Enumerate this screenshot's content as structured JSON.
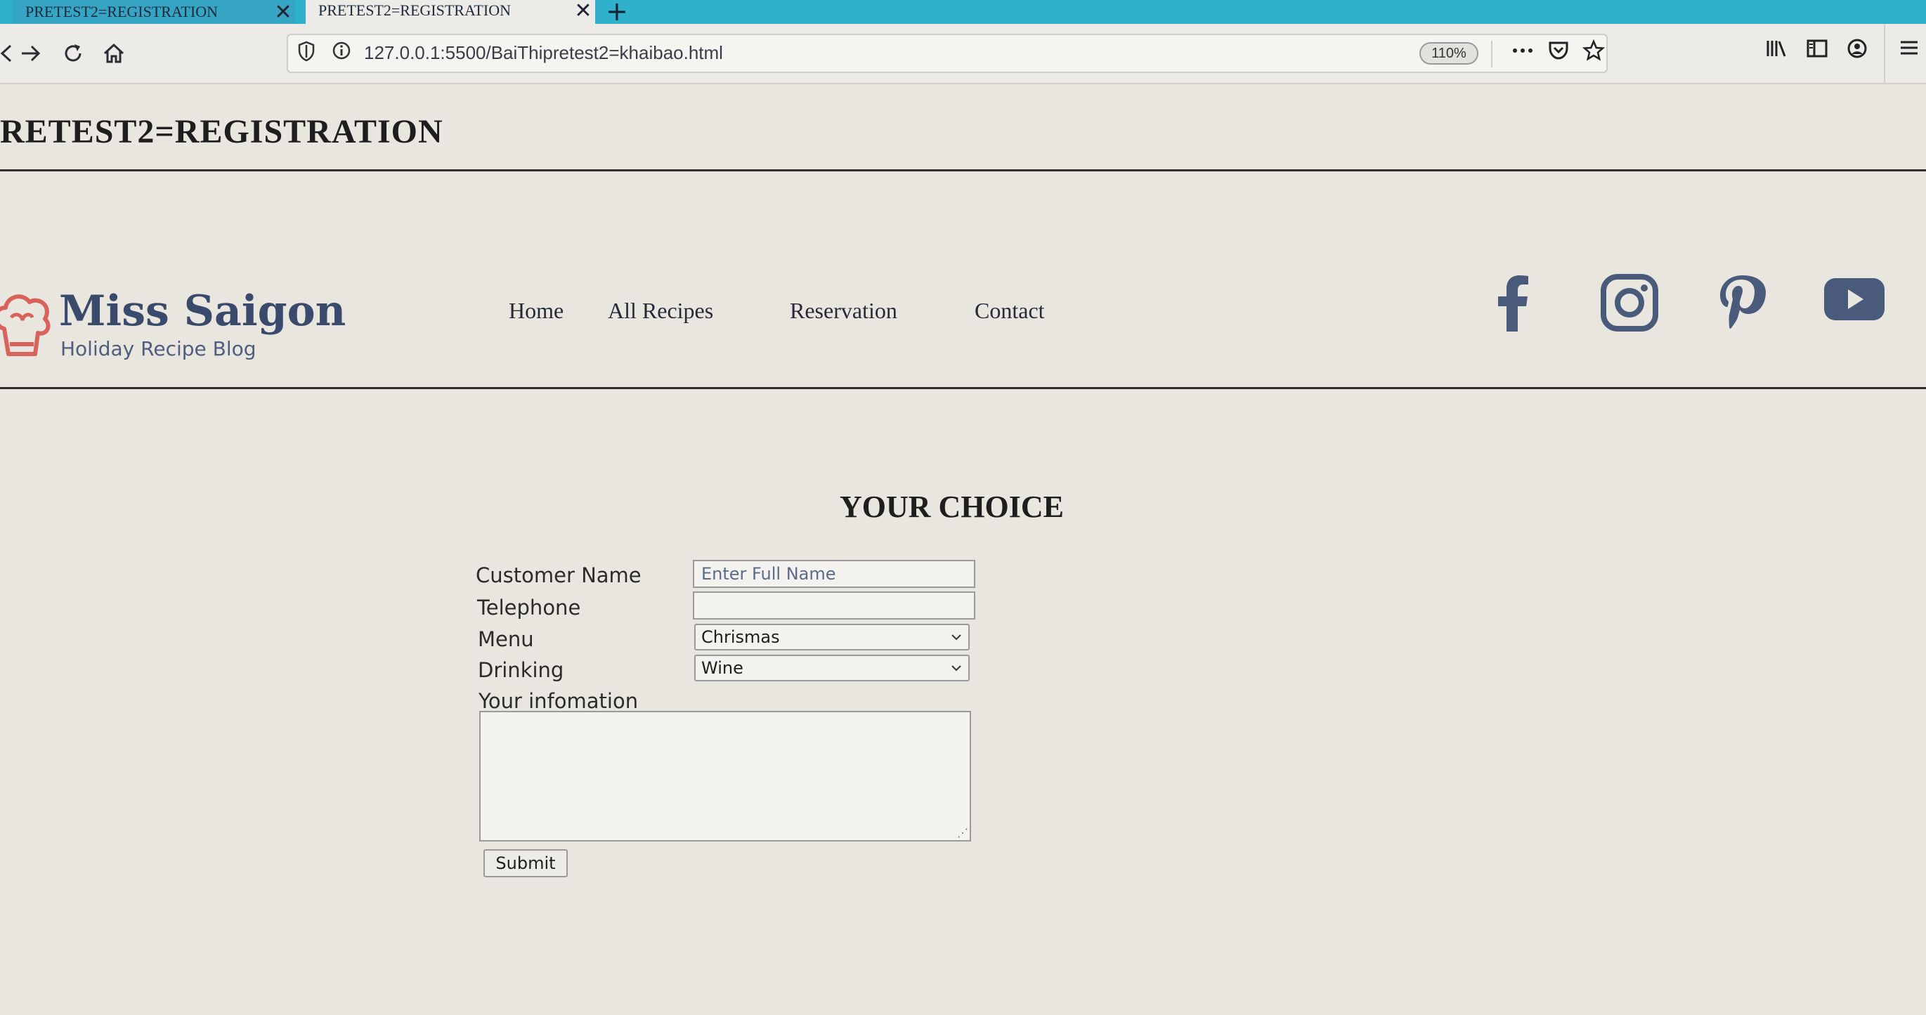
{
  "browser": {
    "tabs": [
      {
        "label": "PRETEST2=REGISTRATION",
        "active": false,
        "close": "✕"
      },
      {
        "label": "PRETEST2=REGISTRATION",
        "active": true,
        "close": "✕"
      }
    ],
    "new_tab": "+",
    "url": "127.0.0.1:5500/BaiThipretest2=khaibao.html",
    "zoom": "110%",
    "icons": {
      "back": "arrow-left-icon",
      "forward": "arrow-right-icon",
      "reload": "reload-icon",
      "home": "home-icon",
      "shield": "shield-icon",
      "info": "info-icon",
      "more": "more-icon",
      "pocket": "pocket-icon",
      "bookmark": "star-icon",
      "library": "library-icon",
      "sidebar": "sidebar-icon",
      "account": "account-icon",
      "menu": "hamburger-menu-icon"
    }
  },
  "page": {
    "title": "RETEST2=REGISTRATION",
    "brand": {
      "name": "Miss Saigon",
      "tagline": "Holiday Recipe Blog",
      "name_color": "#394a6d",
      "logo_color": "#d9635a"
    },
    "nav": [
      "Home",
      "All Recipes",
      "Reservation",
      "Contact"
    ],
    "social": [
      "facebook-icon",
      "instagram-icon",
      "pinterest-icon",
      "youtube-icon"
    ],
    "social_color": "#4a5a7a",
    "section_title": "YOUR CHOICE",
    "form": {
      "customer_name_label": "Customer Name",
      "customer_name_placeholder": "Enter Full Name",
      "customer_name_value": "",
      "telephone_label": "Telephone",
      "telephone_value": "",
      "menu_label": "Menu",
      "menu_value": "Chrismas",
      "drinking_label": "Drinking",
      "drinking_value": "Wine",
      "info_label": "Your infomation",
      "info_value": "",
      "submit_label": "Submit"
    }
  }
}
